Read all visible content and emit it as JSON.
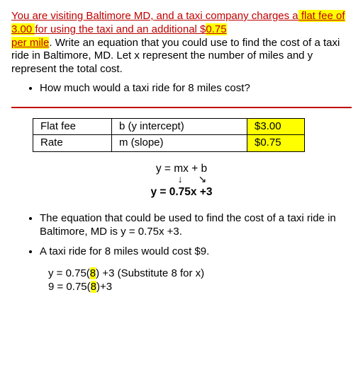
{
  "problem": {
    "p1_a": "You are visiting Baltimore MD, and a taxi company charges a",
    "p1_hl1": " flat fee of 3.00 ",
    "p1_b": "for using the taxi and an additional $",
    "p1_hl2a": "0.75",
    "p1_hl2b": "per mile",
    "p1_c": ".  Write an equation that you could use to find the cost of a taxi ride in Baltimore, MD.  Let x represent the number of miles and y represent the total cost.",
    "bullet1": "How much would a taxi ride for 8 miles cost?"
  },
  "table": {
    "r1c1": "Flat fee",
    "r1c2": "b  (y intercept)",
    "r1c3": "$3.00",
    "r2c1": "Rate",
    "r2c2": "m  (slope)",
    "r2c3": "$0.75"
  },
  "equations": {
    "generic": "y = mx + b",
    "specific": "y = 0.75x +3"
  },
  "answers": {
    "bullet_eq": "The equation that could be used to find the cost of a taxi ride in Baltimore, MD is y = 0.75x +3.",
    "bullet_cost": "A taxi ride for 8 miles would cost $9.",
    "work1_a": "y = 0.75(",
    "work1_hl": "8",
    "work1_b": ") +3   (Substitute 8 for x)",
    "work2_a": "9 = 0.75(",
    "work2_hl": "8",
    "work2_b": ")+3"
  }
}
